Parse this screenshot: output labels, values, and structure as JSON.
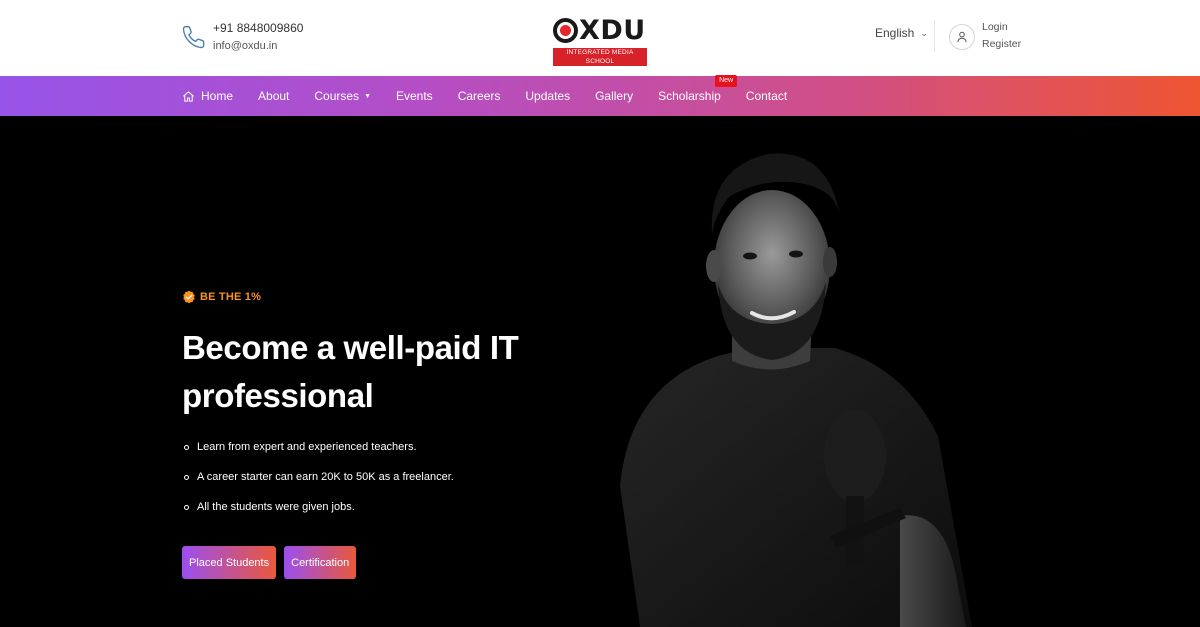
{
  "header": {
    "phone": "+91 8848009860",
    "email": "info@oxdu.in",
    "logo": {
      "wordmark": "OXDU",
      "letters": "XDU",
      "tagline": "INTEGRATED MEDIA SCHOOL"
    },
    "language": "English",
    "login_label": "Login",
    "register_label": "Register"
  },
  "nav": {
    "items": [
      {
        "label": "Home",
        "icon": "home-icon"
      },
      {
        "label": "About"
      },
      {
        "label": "Courses",
        "icon": "caret-down-icon"
      },
      {
        "label": "Events"
      },
      {
        "label": "Careers"
      },
      {
        "label": "Updates"
      },
      {
        "label": "Gallery"
      },
      {
        "label": "Scholarship",
        "badge": "New"
      },
      {
        "label": "Contact"
      }
    ]
  },
  "hero": {
    "tagline": "BE THE 1%",
    "headline": "Become a well-paid IT professional",
    "features": [
      "Learn from expert and experienced teachers.",
      "A career starter can earn 20K to 50K as a freelancer.",
      "All the students were given jobs."
    ],
    "buttons": {
      "placed_students": "Placed Students",
      "certification": "Certification"
    }
  },
  "colors": {
    "nav_gradient_start": "#9654e8",
    "nav_gradient_end": "#ee5532",
    "accent_orange": "#f7931e",
    "logo_red": "#e5262b",
    "new_badge": "#e8111d",
    "hero_background": "#000000"
  }
}
